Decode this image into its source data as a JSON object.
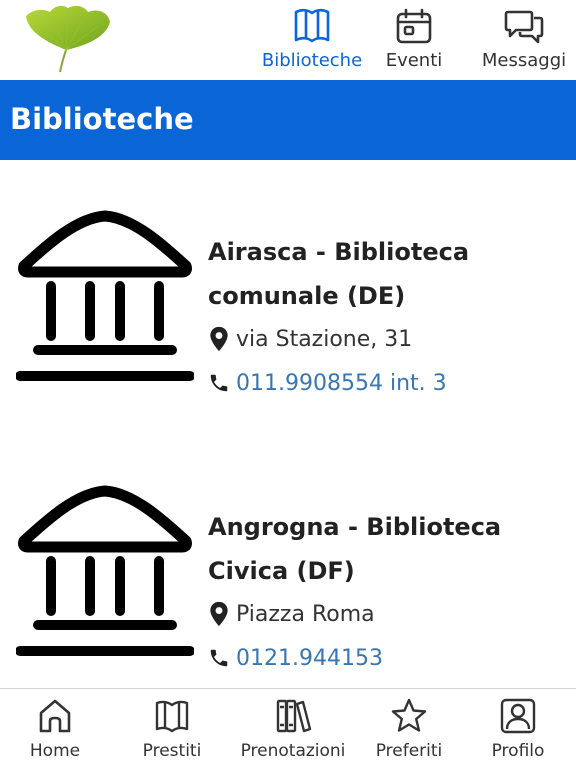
{
  "topnav": {
    "items": [
      {
        "label": "Biblioteche",
        "icon": "book-icon",
        "active": true
      },
      {
        "label": "Eventi",
        "icon": "calendar-icon",
        "active": false
      },
      {
        "label": "Messaggi",
        "icon": "chat-icon",
        "active": false
      }
    ]
  },
  "header": {
    "title": "Biblioteche"
  },
  "libraries": [
    {
      "name": "Airasca - Biblioteca comunale (DE)",
      "address": "via Stazione, 31",
      "phone": "011.9908554 int. 3"
    },
    {
      "name": "Angrogna - Biblioteca Civica (DF)",
      "address": "Piazza Roma",
      "phone": "0121.944153"
    }
  ],
  "bottomnav": {
    "items": [
      {
        "label": "Home",
        "icon": "home-icon"
      },
      {
        "label": "Prestiti",
        "icon": "book-open-icon"
      },
      {
        "label": "Prenotazioni",
        "icon": "books-icon"
      },
      {
        "label": "Preferiti",
        "icon": "star-icon"
      },
      {
        "label": "Profilo",
        "icon": "user-icon"
      }
    ]
  },
  "colors": {
    "accent": "#0a66d6",
    "link": "#3776b0"
  }
}
